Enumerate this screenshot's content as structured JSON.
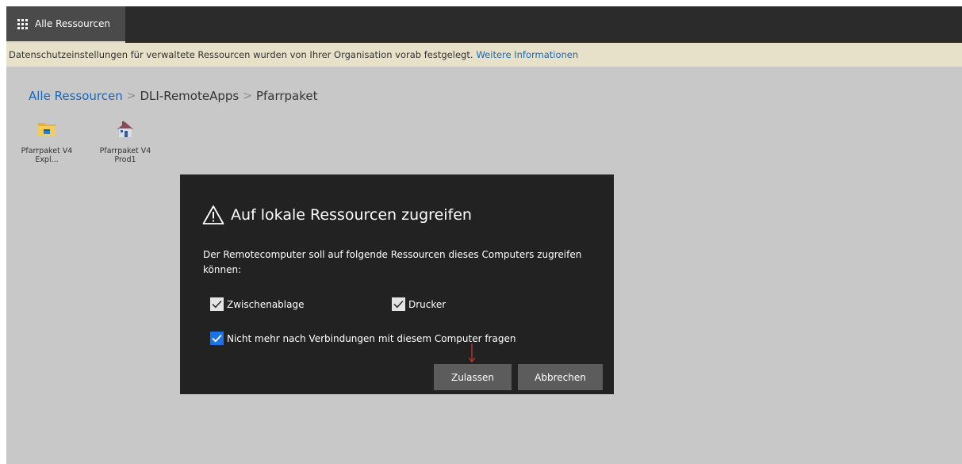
{
  "topbar": {
    "tab_label": "Alle Ressourcen",
    "tab_icon": "grid-icon"
  },
  "notice": {
    "text": "Datenschutzeinstellungen für verwaltete Ressourcen wurden von Ihrer Organisation vorab festgelegt.",
    "link": "Weitere Informationen"
  },
  "breadcrumb": {
    "items": [
      "Alle Ressourcen",
      "DLI-RemoteApps",
      "Pfarrpaket"
    ],
    "separator": ">"
  },
  "tiles": [
    {
      "line1": "Pfarrpaket V4",
      "line2": "Expl...",
      "icon": "folder-explorer-icon"
    },
    {
      "line1": "Pfarrpaket V4",
      "line2": "Prod1",
      "icon": "house-app-icon"
    }
  ],
  "dialog": {
    "title": "Auf lokale Ressourcen zugreifen",
    "description": "Der Remotecomputer soll auf folgende Ressourcen dieses Computers zugreifen können:",
    "checkboxes": {
      "clipboard": {
        "label": "Zwischenablage",
        "checked": true
      },
      "printer": {
        "label": "Drucker",
        "checked": true
      },
      "dont_ask": {
        "label": "Nicht mehr nach Verbindungen mit diesem Computer fragen",
        "checked": true
      }
    },
    "buttons": {
      "allow": "Zulassen",
      "cancel": "Abbrechen"
    }
  },
  "colors": {
    "topbar": "#2b2b2b",
    "tab": "#4a4a4a",
    "notice_bg": "#e7e1c9",
    "link": "#1a66b8",
    "page_bg": "#c8c8c8",
    "dialog_bg": "#222222",
    "checkbox_blue": "#1a73e8",
    "button_bg": "#5c5c5c",
    "cursor_arrow": "#c0392b"
  }
}
